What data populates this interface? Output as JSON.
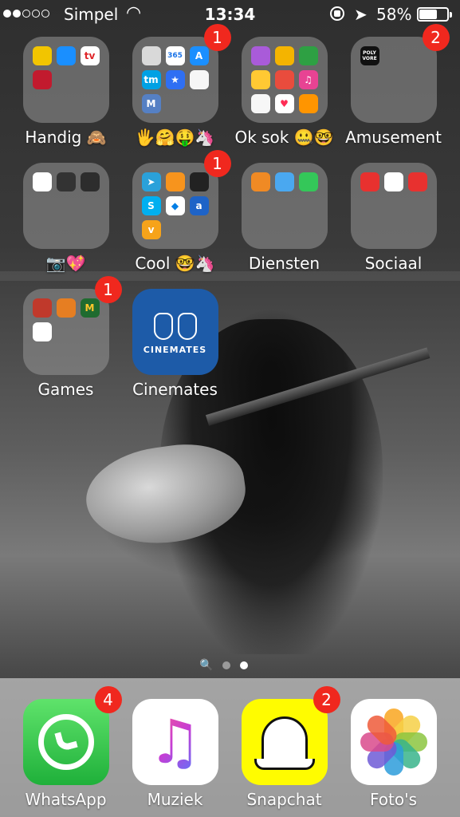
{
  "status_bar": {
    "carrier": "Simpel",
    "time": "13:34",
    "battery": "58%"
  },
  "apps": [
    {
      "label": "Handig 🙈",
      "type": "folder",
      "badge": ""
    },
    {
      "label": "🖐🤗🤑🦄",
      "type": "folder",
      "badge": "1"
    },
    {
      "label": "Ok sok 🤐🤓",
      "type": "folder",
      "badge": ""
    },
    {
      "label": "Amusement",
      "type": "folder",
      "badge": "2"
    },
    {
      "label": "📷💖",
      "type": "folder",
      "badge": ""
    },
    {
      "label": "Cool 🤓🦄",
      "type": "folder",
      "badge": "1"
    },
    {
      "label": "Diensten",
      "type": "folder",
      "badge": ""
    },
    {
      "label": "Sociaal",
      "type": "folder",
      "badge": ""
    },
    {
      "label": "Games",
      "type": "folder",
      "badge": "1"
    },
    {
      "label": "Cinemates",
      "type": "app",
      "badge": "",
      "brand_text": "CINEMATES"
    }
  ],
  "mini_icon_text": {
    "amusement": [
      "POLY",
      "VORE"
    ],
    "cool_tm": "tm",
    "cool_m": "M",
    "cool_a": "a",
    "cool_v": "v",
    "games_mc": "M"
  },
  "dock": [
    {
      "label": "WhatsApp",
      "badge": "4"
    },
    {
      "label": "Muziek",
      "badge": ""
    },
    {
      "label": "Snapchat",
      "badge": "2"
    },
    {
      "label": "Foto's",
      "badge": ""
    }
  ],
  "page_indicator": {
    "pages": 2,
    "active": 2
  }
}
